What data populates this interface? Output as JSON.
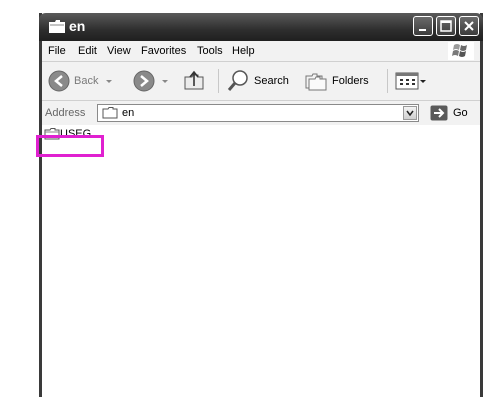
{
  "window": {
    "title": "en",
    "title_icon": "folder-icon",
    "controls": [
      "minimize-icon",
      "maximize-icon",
      "close-icon"
    ]
  },
  "menu": {
    "items": [
      "File",
      "Edit",
      "View",
      "Favorites",
      "Tools",
      "Help"
    ],
    "logo": "windows-logo-icon"
  },
  "toolbar": {
    "back_label": "Back",
    "search_label": "Search",
    "folders_label": "Folders",
    "icons": [
      "back-arrow-icon",
      "forward-arrow-icon",
      "up-folder-icon",
      "search-icon",
      "folders-icon",
      "views-icon"
    ]
  },
  "address": {
    "label": "Address",
    "value": "en",
    "go_label": "Go"
  },
  "content": {
    "items": [
      {
        "name": "USEG",
        "icon": "folder-icon"
      }
    ]
  },
  "colors": {
    "titlebar": "#2e2e2e",
    "highlight": "#e020d0"
  }
}
